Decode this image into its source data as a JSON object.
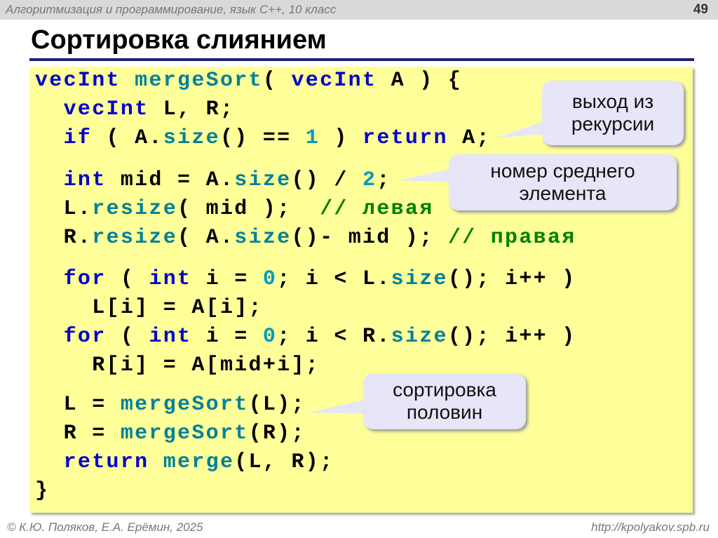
{
  "header": {
    "course": "Алгоритмизация и программирование, язык C++, 10 класс",
    "page_number": "49"
  },
  "title": "Сортировка слиянием",
  "code_lines": [
    [
      [
        "vecInt ",
        "kw"
      ],
      [
        "mergeSort",
        "fn"
      ],
      [
        "( ",
        ""
      ],
      [
        "vecInt ",
        "kw"
      ],
      [
        "A ) {",
        ""
      ]
    ],
    [
      [
        "  ",
        ""
      ],
      [
        "vecInt ",
        "kw"
      ],
      [
        "L, R;",
        ""
      ]
    ],
    [
      [
        "  ",
        ""
      ],
      [
        "if",
        "kw"
      ],
      [
        " ( A.",
        ""
      ],
      [
        "size",
        "fn"
      ],
      [
        "() == ",
        ""
      ],
      [
        "1",
        "num"
      ],
      [
        " ) ",
        ""
      ],
      [
        "return ",
        "kw"
      ],
      [
        "A;",
        ""
      ]
    ],
    [
      [
        "  ",
        ""
      ],
      [
        "int ",
        "kw"
      ],
      [
        "mid = A.",
        ""
      ],
      [
        "size",
        "fn"
      ],
      [
        "() / ",
        ""
      ],
      [
        "2",
        "num"
      ],
      [
        ";",
        ""
      ]
    ],
    [
      [
        "  L.",
        ""
      ],
      [
        "resize",
        "fn"
      ],
      [
        "( mid );  ",
        ""
      ],
      [
        "// левая",
        "cm"
      ]
    ],
    [
      [
        "  R.",
        ""
      ],
      [
        "resize",
        "fn"
      ],
      [
        "( A.",
        ""
      ],
      [
        "size",
        "fn"
      ],
      [
        "()- mid ); ",
        ""
      ],
      [
        "// правая",
        "cm"
      ]
    ],
    [
      [
        "  ",
        ""
      ],
      [
        "for",
        "kw"
      ],
      [
        " ( ",
        ""
      ],
      [
        "int ",
        "kw"
      ],
      [
        "i = ",
        ""
      ],
      [
        "0",
        "num"
      ],
      [
        "; i < L.",
        ""
      ],
      [
        "size",
        "fn"
      ],
      [
        "(); i++ )",
        ""
      ]
    ],
    [
      [
        "    L[i] = A[i];",
        ""
      ]
    ],
    [
      [
        "  ",
        ""
      ],
      [
        "for",
        "kw"
      ],
      [
        " ( ",
        ""
      ],
      [
        "int ",
        "kw"
      ],
      [
        "i = ",
        ""
      ],
      [
        "0",
        "num"
      ],
      [
        "; i < R.",
        ""
      ],
      [
        "size",
        "fn"
      ],
      [
        "(); i++ )",
        ""
      ]
    ],
    [
      [
        "    R[i] = A[mid+i];",
        ""
      ]
    ],
    [
      [
        "  L = ",
        ""
      ],
      [
        "mergeSort",
        "fn"
      ],
      [
        "(L);",
        ""
      ]
    ],
    [
      [
        "  R = ",
        ""
      ],
      [
        "mergeSort",
        "fn"
      ],
      [
        "(R);",
        ""
      ]
    ],
    [
      [
        "  ",
        ""
      ],
      [
        "return ",
        "kw"
      ],
      [
        "merge",
        "fn"
      ],
      [
        "(L, R);",
        ""
      ]
    ],
    [
      [
        "}",
        ""
      ]
    ]
  ],
  "callouts": [
    {
      "line1": "выход из",
      "line2": "рекурсии"
    },
    {
      "line1": "номер среднего",
      "line2": "элемента"
    },
    {
      "line1": "сортировка",
      "line2": "половин"
    }
  ],
  "footer": {
    "authors": "© К.Ю. Поляков, Е.А. Ерёмин, 2025",
    "url": "http://kpolyakov.spb.ru"
  }
}
